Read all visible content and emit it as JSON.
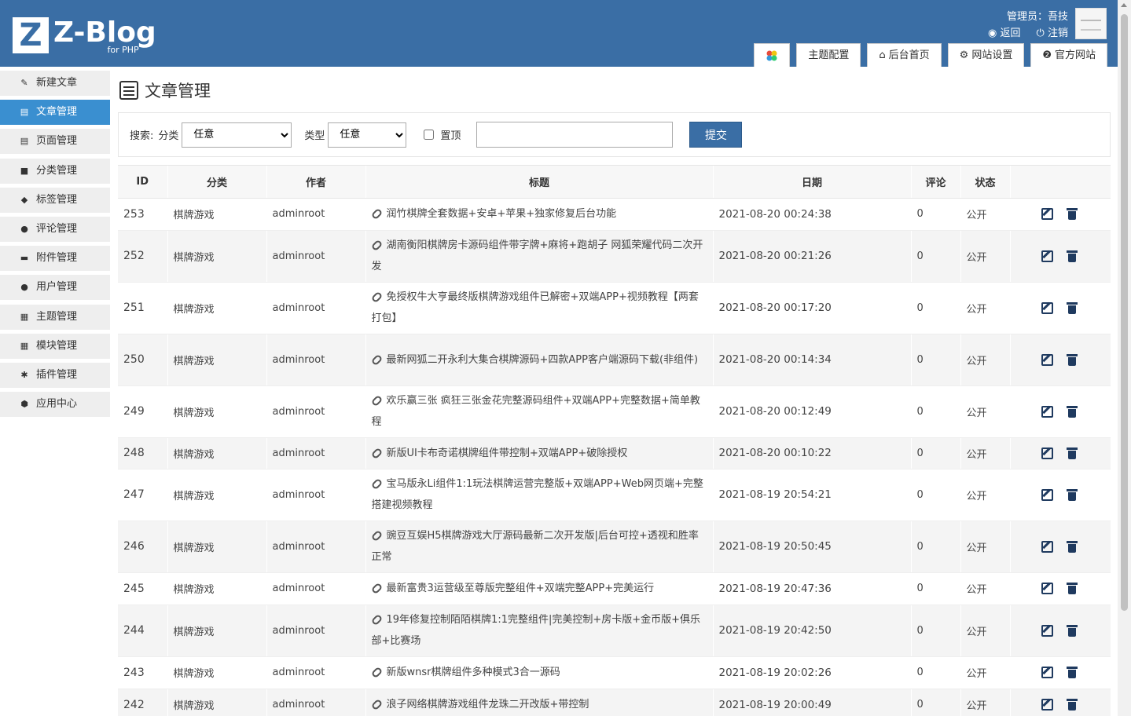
{
  "header": {
    "logo_letter": "Z",
    "logo_text": "Z-Blog",
    "logo_sub": "for PHP",
    "admin_label": "管理员：吾技",
    "back_label": "返回",
    "logout_label": "注销",
    "tabs": [
      {
        "label": ""
      },
      {
        "label": "主题配置"
      },
      {
        "label": "后台首页"
      },
      {
        "label": "网站设置"
      },
      {
        "label": "官方网站"
      }
    ]
  },
  "sidebar": {
    "items": [
      {
        "label": "新建文章"
      },
      {
        "label": "文章管理"
      },
      {
        "label": "页面管理"
      },
      {
        "label": "分类管理"
      },
      {
        "label": "标签管理"
      },
      {
        "label": "评论管理"
      },
      {
        "label": "附件管理"
      },
      {
        "label": "用户管理"
      },
      {
        "label": "主题管理"
      },
      {
        "label": "模块管理"
      },
      {
        "label": "插件管理"
      },
      {
        "label": "应用中心"
      }
    ]
  },
  "main": {
    "title": "文章管理",
    "search": {
      "label": "搜索:",
      "category_label": "分类",
      "category_value": "任意",
      "type_label": "类型",
      "type_value": "任意",
      "top_label": "置顶",
      "keyword_value": "",
      "submit_label": "提交"
    },
    "columns": [
      "ID",
      "分类",
      "作者",
      "标题",
      "日期",
      "评论",
      "状态",
      ""
    ],
    "rows": [
      {
        "id": "253",
        "category": "棋牌游戏",
        "author": "adminroot",
        "title": "润竹棋牌全套数据+安卓+苹果+独家修复后台功能",
        "date": "2021-08-20 00:24:38",
        "comments": "0",
        "status": "公开"
      },
      {
        "id": "252",
        "category": "棋牌游戏",
        "author": "adminroot",
        "title": "湖南衡阳棋牌房卡源码组件带字牌+麻将+跑胡子 网狐荣耀代码二次开发",
        "date": "2021-08-20 00:21:26",
        "comments": "0",
        "status": "公开"
      },
      {
        "id": "251",
        "category": "棋牌游戏",
        "author": "adminroot",
        "title": "免授权牛大亨最终版棋牌游戏组件已解密+双端APP+视频教程【两套打包】",
        "date": "2021-08-20 00:17:20",
        "comments": "0",
        "status": "公开"
      },
      {
        "id": "250",
        "category": "棋牌游戏",
        "author": "adminroot",
        "title": "最新网狐二开永利大集合棋牌源码+四款APP客户端源码下载(非组件)",
        "date": "2021-08-20 00:14:34",
        "comments": "0",
        "status": "公开"
      },
      {
        "id": "249",
        "category": "棋牌游戏",
        "author": "adminroot",
        "title": "欢乐赢三张 疯狂三张金花完整源码组件+双端APP+完整数据+简单教程",
        "date": "2021-08-20 00:12:49",
        "comments": "0",
        "status": "公开"
      },
      {
        "id": "248",
        "category": "棋牌游戏",
        "author": "adminroot",
        "title": "新版UI卡布奇诺棋牌组件带控制+双端APP+破除授权",
        "date": "2021-08-20 00:10:22",
        "comments": "0",
        "status": "公开"
      },
      {
        "id": "247",
        "category": "棋牌游戏",
        "author": "adminroot",
        "title": "宝马版永Li组件1:1玩法棋牌运营完整版+双端APP+Web网页端+完整搭建视频教程",
        "date": "2021-08-19 20:54:21",
        "comments": "0",
        "status": "公开"
      },
      {
        "id": "246",
        "category": "棋牌游戏",
        "author": "adminroot",
        "title": "豌豆互娱H5棋牌游戏大厅源码最新二次开发版|后台可控+透视和胜率正常",
        "date": "2021-08-19 20:50:45",
        "comments": "0",
        "status": "公开"
      },
      {
        "id": "245",
        "category": "棋牌游戏",
        "author": "adminroot",
        "title": "最新富贵3运营级至尊版完整组件+双端完整APP+完美运行",
        "date": "2021-08-19 20:47:36",
        "comments": "0",
        "status": "公开"
      },
      {
        "id": "244",
        "category": "棋牌游戏",
        "author": "adminroot",
        "title": "19年修复控制陌陌棋牌1:1完整组件|完美控制+房卡版+金币版+俱乐部+比赛场",
        "date": "2021-08-19 20:42:50",
        "comments": "0",
        "status": "公开"
      },
      {
        "id": "243",
        "category": "棋牌游戏",
        "author": "adminroot",
        "title": "新版wnsr棋牌组件多种模式3合一源码",
        "date": "2021-08-19 20:02:26",
        "comments": "0",
        "status": "公开"
      },
      {
        "id": "242",
        "category": "棋牌游戏",
        "author": "adminroot",
        "title": "浪子网络棋牌游戏组件龙珠二开改版+带控制",
        "date": "2021-08-19 20:00:49",
        "comments": "0",
        "status": "公开"
      }
    ]
  },
  "colors": {
    "header_bg": "#3a6ea5",
    "active_sidebar": "#3a8fd0",
    "action_icon": "#1f3a5f"
  }
}
